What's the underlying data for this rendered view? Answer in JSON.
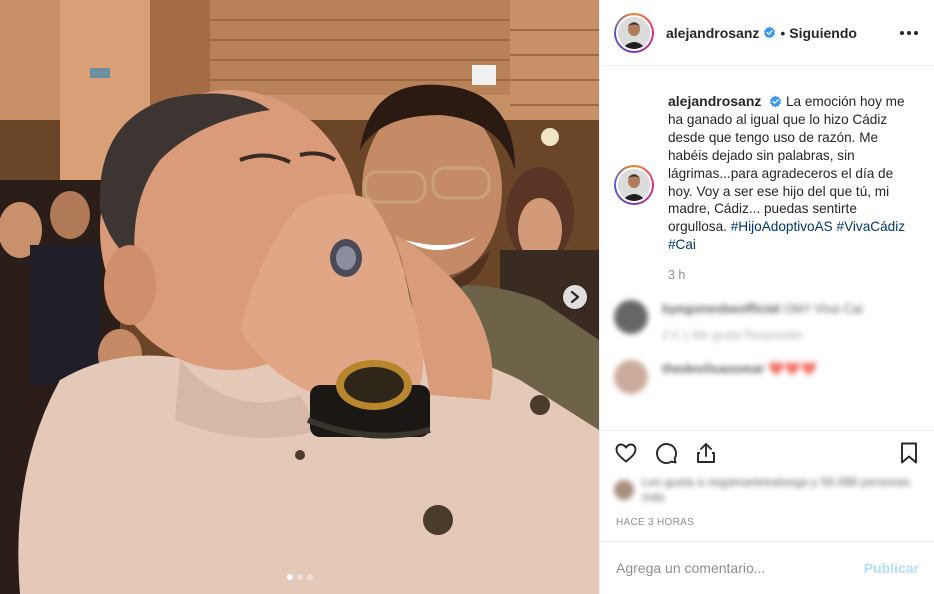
{
  "post": {
    "author": "alejandrosanz",
    "verified": true,
    "follow_separator": "•",
    "follow_status": "Siguiendo",
    "caption_text": "La emoción hoy me ha ganado al igual que lo hizo Cádiz desde que tengo uso de razón. Me habéis dejado sin palabras, sin lágrimas...para agradeceros el día de hoy. Voy a ser ese hijo del que tú, mi madre, Cádiz... puedas sentirte orgullosa.",
    "hashtags": [
      "#HijoAdoptivoAS",
      "#VivaCádiz",
      "#Cai"
    ],
    "time_ago": "3 h",
    "date_label": "HACE 3 HORAS"
  },
  "carousel": {
    "slide_count": 3,
    "active_index": 0
  },
  "comments": [
    {
      "user": "byegonesbeofficial",
      "text": "Olé!! Viva Cai",
      "meta": "2 h   1 Me gusta   Responder"
    },
    {
      "user": "thedevilsaosmar",
      "text": "❤️❤️❤️"
    }
  ],
  "likes_text": "Les gusta a vegamartelvalvega y 56.088 personas más",
  "add_comment": {
    "placeholder": "Agrega un comentario...",
    "publish_label": "Publicar"
  },
  "icons": [
    "more-options-icon",
    "verified-badge-icon",
    "heart-icon",
    "comment-icon",
    "share-icon",
    "bookmark-icon",
    "chevron-right-icon"
  ],
  "colors": {
    "link": "#00376b",
    "muted": "#8e8e8e",
    "publish_disabled": "#b2dffc",
    "verified": "#3897f0"
  }
}
